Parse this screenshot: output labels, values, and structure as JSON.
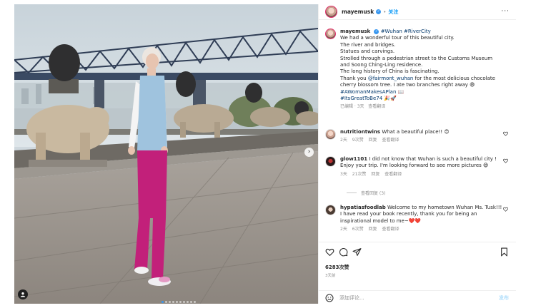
{
  "post": {
    "username": "mayemusk",
    "follow_label": "关注",
    "more_label": "···"
  },
  "caption": {
    "username": "mayemusk",
    "hashtags_inline": "#Wuhan #RiverCity",
    "lines": [
      "We had a wonderful tour of this beautiful city.",
      "The river and bridges.",
      "Statues and carvings.",
      "Strolled through a pedestrian street to the Customs Museum",
      "and Soong Ching-Ling residence.",
      "The long history of China is fascinating."
    ],
    "thanks_prefix": "Thank you ",
    "thanks_mention": "@fairmont_wuhan",
    "thanks_suffix": " for the most delicious chocolate",
    "thanks_line2": "cherry blossom tree. I ate two branches right away 😄",
    "tag1": "#AWomanMakesAPlan 📖",
    "tag2": "#ItsGreatToBe74 🎉🚀",
    "meta_edited": "已编辑 · 3天",
    "meta_translate": "查看翻译"
  },
  "comments": [
    {
      "username": "nutritiontwins",
      "text": "What a beautiful place!! 😍",
      "time": "2天",
      "likes": "9次赞",
      "reply": "回复",
      "translate": "查看翻译"
    },
    {
      "username": "glow1101",
      "text": "I did not know that Wuhan is such a beautiful city ! Enjoy your trip. I'm looking forward to see more pictures 😄",
      "time": "3天",
      "likes": "21次赞",
      "reply": "回复",
      "translate": "查看翻译"
    },
    {
      "username": "hypatiasfoodlab",
      "text": "Welcome to my hometown Wuhan Ms. Tusk!!! I have read your book recently, thank you for being an inspirational model to me~❤️❤️",
      "time": "2天",
      "likes": "6次赞",
      "reply": "回复",
      "translate": "查看翻译"
    }
  ],
  "view_replies": "查看回复 (3)",
  "likes_count": "6283次赞",
  "post_date": "3天前",
  "add_comment_placeholder": "添加评论...",
  "post_button": "发布",
  "colors": {
    "accent": "#0095f6",
    "verified": "#3897f0",
    "pants": "#c2207a",
    "vest": "#9fc3de"
  }
}
